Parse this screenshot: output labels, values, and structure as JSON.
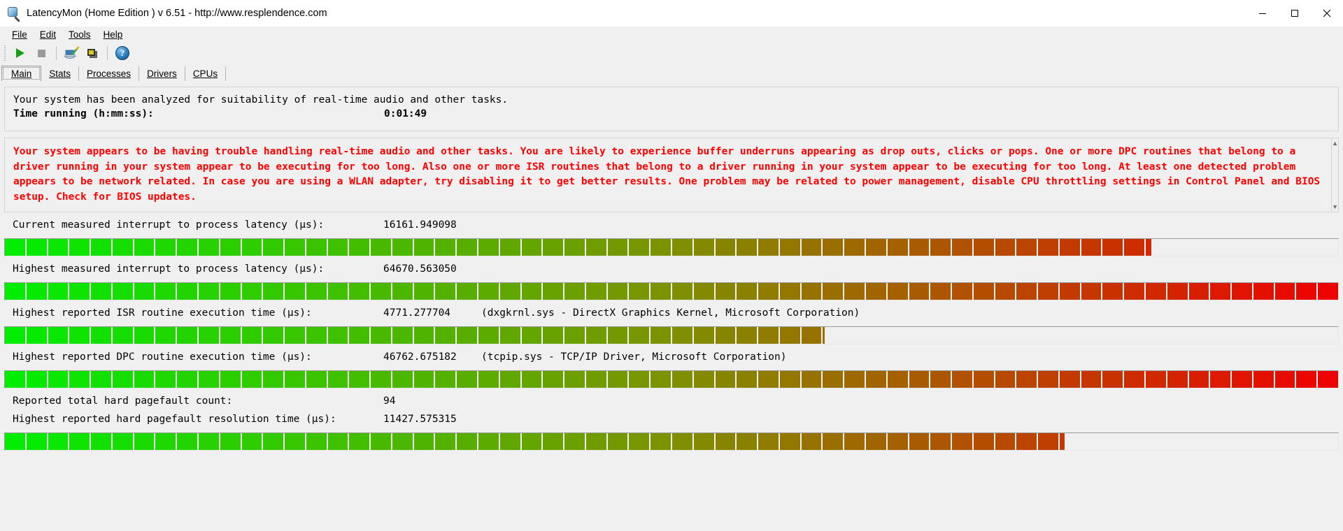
{
  "window": {
    "title": "LatencyMon  (Home Edition )  v 6.51 - http://www.resplendence.com",
    "app_icon": "latencymon-magnifier-icon",
    "minimize_label": "Minimize",
    "maximize_label": "Maximize",
    "close_label": "Close"
  },
  "menu": {
    "items": [
      {
        "label": "File",
        "accel": "F"
      },
      {
        "label": "Edit",
        "accel": "E"
      },
      {
        "label": "Tools",
        "accel": "T"
      },
      {
        "label": "Help",
        "accel": "H"
      }
    ]
  },
  "toolbar": {
    "buttons": [
      {
        "name": "start-monitoring-button",
        "icon": "play-icon",
        "tooltip": "Start monitoring"
      },
      {
        "name": "stop-monitoring-button",
        "icon": "stop-icon",
        "tooltip": "Stop monitoring"
      },
      {
        "name": "report-button",
        "icon": "report-wizard-icon",
        "tooltip": "Report"
      },
      {
        "name": "copy-button",
        "icon": "copy-windows-icon",
        "tooltip": "Copy"
      },
      {
        "name": "help-button",
        "icon": "help-question-icon",
        "tooltip": "Help"
      }
    ]
  },
  "tabs": {
    "items": [
      {
        "label": "Main",
        "accel": "M",
        "active": true
      },
      {
        "label": "Stats",
        "accel": "S",
        "active": false
      },
      {
        "label": "Processes",
        "accel": "P",
        "active": false
      },
      {
        "label": "Drivers",
        "accel": "D",
        "active": false
      },
      {
        "label": "CPUs",
        "accel": "C",
        "active": false
      }
    ]
  },
  "summary": {
    "headline": "Your system has been analyzed for suitability of real-time audio and other tasks.",
    "time_running_label": "Time running (h:mm:ss):",
    "time_running_value": "0:01:49"
  },
  "warning": {
    "color": "#ff0000",
    "text": "Your system appears to be having trouble handling real-time audio and other tasks. You are likely to experience buffer underruns appearing as drop outs, clicks or pops. One or more DPC routines that belong to a driver running in your system appear to be executing for too long. Also one or more ISR routines that belong to a driver running in your system appear to be executing for too long. At least one detected problem appears to be network related. In case you are using a WLAN adapter, try disabling it to get better results. One problem may be related to power management, disable CPU throttling settings in Control Panel and BIOS setup. Check for BIOS updates.",
    "scrollbar_up": "▲",
    "scrollbar_down": "▼"
  },
  "metrics": [
    {
      "name": "current-interrupt-to-process-latency",
      "label": "Current measured interrupt to process latency (µs):",
      "value": "16161.949098",
      "extra": "",
      "bar_percent": 86,
      "bar_end_color": "#e01000"
    },
    {
      "name": "highest-interrupt-to-process-latency",
      "label": "Highest measured interrupt to process latency (µs):",
      "value": "64670.563050",
      "extra": "",
      "bar_percent": 100,
      "bar_end_color": "#f00000"
    },
    {
      "name": "highest-isr-routine-execution-time",
      "label": "Highest reported ISR routine execution time (µs):",
      "value": "4771.277704",
      "extra": "(dxgkrnl.sys - DirectX Graphics Kernel, Microsoft Corporation)",
      "bar_percent": 61.5,
      "bar_end_color": "#a81505"
    },
    {
      "name": "highest-dpc-routine-execution-time",
      "label": "Highest reported DPC routine execution time (µs):",
      "value": "46762.675182",
      "extra": "(tcpip.sys - TCP/IP Driver, Microsoft Corporation)",
      "bar_percent": 100,
      "bar_end_color": "#f00000"
    }
  ],
  "pagefault": {
    "count_label": "Reported total hard pagefault count:",
    "count_value": "94",
    "time_label": "Highest reported hard pagefault resolution time (µs):",
    "time_value": "11427.575315",
    "bar_percent": 79.5,
    "bar_end_color": "#b71607"
  },
  "bar_palette": {
    "start": "#00ee00",
    "mid": "#7e9100",
    "end": "#f00000",
    "segment_count": 62
  }
}
